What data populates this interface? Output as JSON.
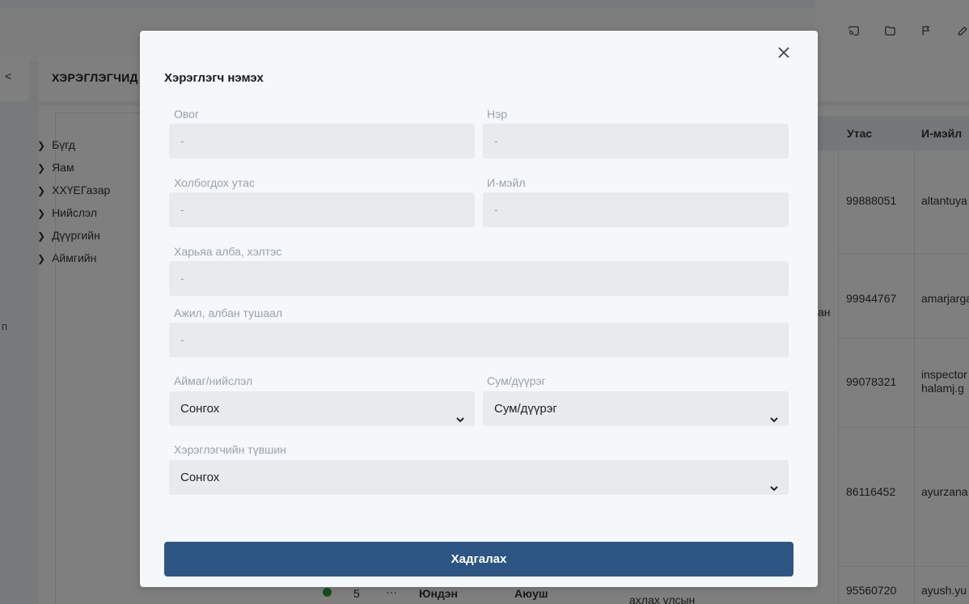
{
  "background": {
    "sidebar_card_text": "<",
    "left_letter": "п",
    "page_title": "ХЭРЭГЛЭГЧИД",
    "tree": [
      {
        "label": "Бүгд"
      },
      {
        "label": "Яам"
      },
      {
        "label": "ХХҮЕГазар"
      },
      {
        "label": "Нийслэл"
      },
      {
        "label": "Дүүргийн"
      },
      {
        "label": "Аймгийн"
      }
    ],
    "table": {
      "headers": {
        "phone": "Утас",
        "email": "И-мэйл"
      },
      "rows": [
        {
          "phone": "99888051",
          "email": "altantuya"
        },
        {
          "phone": "99944767",
          "email": "amarjargal",
          "extra": "ан"
        },
        {
          "phone": "99078321",
          "email_line1": "inspector",
          "email_line2": "halamj.g"
        },
        {
          "phone": "86116452",
          "email": "ayurzana"
        },
        {
          "phone": "95560720",
          "email": "ayush.yu"
        }
      ],
      "bottom_row": {
        "num": "5",
        "dots": "···",
        "lastname": "Юндэн",
        "firstname": "Аюуш",
        "org": "ахлах улсын"
      }
    }
  },
  "modal": {
    "title": "Хэрэглэгч нэмэх",
    "fields": {
      "lastname": {
        "label": "Овог",
        "placeholder": "-"
      },
      "firstname": {
        "label": "Нэр",
        "placeholder": "-"
      },
      "phone": {
        "label": "Холбогдох утас",
        "placeholder": "-"
      },
      "email": {
        "label": "И-мэйл",
        "placeholder": "-"
      },
      "department": {
        "label": "Харьяа алба, хэлтэс",
        "placeholder": "-"
      },
      "position": {
        "label": "Ажил, албан тушаал",
        "placeholder": "-"
      },
      "province": {
        "label": "Аймаг/нийслэл",
        "value": "Сонгох"
      },
      "district": {
        "label": "Сум/дүүрэг",
        "value": "Сум/дүүрэг"
      },
      "user_level": {
        "label": "Хэрэглэгчийн түвшин",
        "value": "Сонгох"
      }
    },
    "save_label": "Хадгалах"
  },
  "colors": {
    "primary_button": "#2d5584",
    "input_background": "#e8ebee",
    "modal_background": "#f5f8fa",
    "status_active": "#2e9a3a"
  },
  "icons": [
    "cast-icon",
    "folder-icon",
    "flag-icon",
    "edit-icon",
    "close-icon",
    "chevron-down-icon",
    "chevron-right-icon"
  ]
}
